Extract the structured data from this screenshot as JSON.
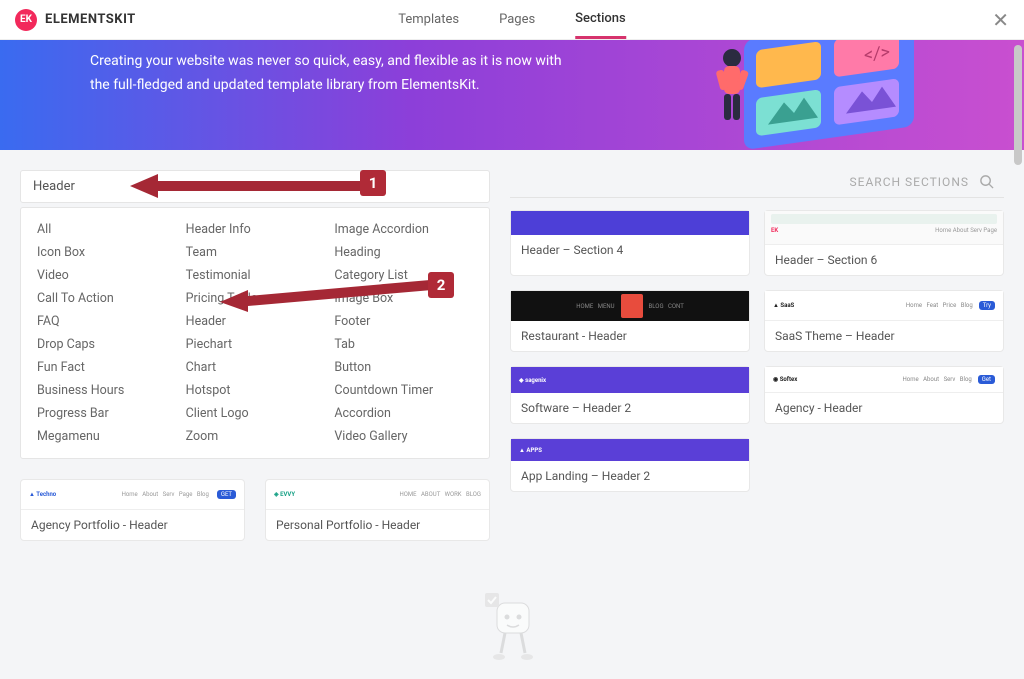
{
  "header": {
    "logo_badge": "EK",
    "logo_text": "ELEMENTSKIT",
    "tabs": {
      "templates": "Templates",
      "pages": "Pages",
      "sections": "Sections"
    }
  },
  "hero": {
    "line1": "Creating your website was never so quick, easy, and flexible as it is now with",
    "line2": "the full-fledged and updated template library from ElementsKit."
  },
  "filter": {
    "value": "Header"
  },
  "search_sections_placeholder": "SEARCH SECTIONS",
  "categories": {
    "col1": [
      "All",
      "Icon Box",
      "Video",
      "Call To Action",
      "FAQ",
      "Drop Caps",
      "Fun Fact",
      "Business Hours",
      "Progress Bar",
      "Megamenu"
    ],
    "col2": [
      "Header Info",
      "Team",
      "Testimonial",
      "Pricing Table",
      "Header",
      "Piechart",
      "Chart",
      "Hotspot",
      "Client Logo",
      "Zoom"
    ],
    "col3": [
      "Image Accordion",
      "Heading",
      "Category List",
      "Image Box",
      "Footer",
      "Tab",
      "Button",
      "Countdown Timer",
      "Accordion",
      "Video Gallery"
    ]
  },
  "bottom_cards": {
    "c1": "Agency Portfolio - Header",
    "c2": "Personal Portfolio - Header"
  },
  "grid_cards": {
    "r1c1": "Header – Section 4",
    "r1c2": "Header – Section 6",
    "r2c1": "Restaurant - Header",
    "r2c2": "SaaS Theme – Header",
    "r3c1": "Software – Header 2",
    "r3c2": "Agency - Header",
    "r4c1": "App Landing – Header 2"
  },
  "callouts": {
    "one": "1",
    "two": "2"
  }
}
